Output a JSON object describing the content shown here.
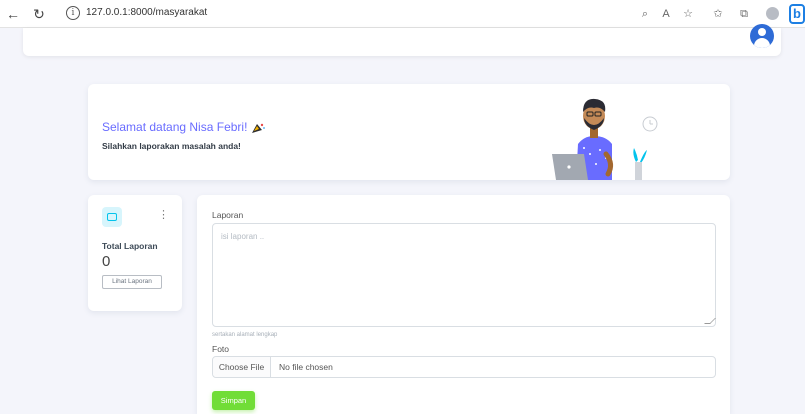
{
  "browser": {
    "url": "127.0.0.1:8000/masyarakat",
    "back_glyph": "←",
    "reload_glyph": "↻",
    "info_glyph": "i",
    "icons": [
      "zoom-icon",
      "read-aloud-icon",
      "favorite-icon",
      "favorites-bar-icon",
      "collections-icon",
      "profile-icon",
      "more-icon",
      "bing-icon"
    ],
    "zoom_glyph": "⌕",
    "read_glyph": "A",
    "fav_glyph": "☆",
    "favbar_glyph": "✩",
    "collections_glyph": "⧉",
    "more_glyph": "···",
    "bing_glyph": "b"
  },
  "welcome": {
    "title": "Selamat datang Nisa Febri!",
    "subtitle": "Silahkan laporakan masalah anda!"
  },
  "stats": {
    "label": "Total Laporan",
    "count": "0",
    "button": "Lihat Laporan",
    "menu_glyph": "⋮"
  },
  "form": {
    "laporan_label": "Laporan",
    "laporan_placeholder": "isi laporan ..",
    "laporan_hint": "sertakan alamat lengkap",
    "foto_label": "Foto",
    "choose_file": "Choose File",
    "no_file": "No file chosen",
    "submit": "Simpan"
  },
  "colors": {
    "primary": "#696cff",
    "success": "#71dd37",
    "info": "#03c3ec",
    "avatar": "#2e6bd6"
  }
}
